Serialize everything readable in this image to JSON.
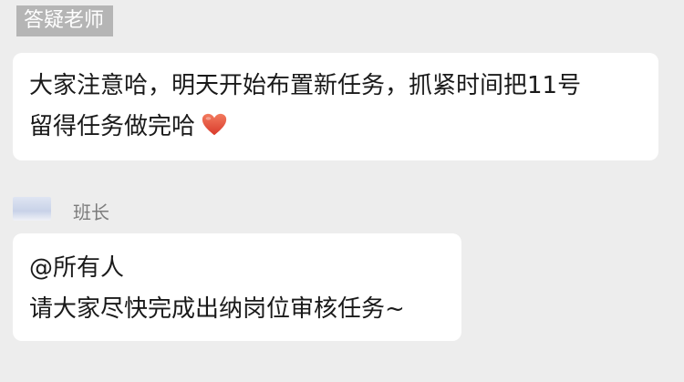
{
  "chat": {
    "messages": [
      {
        "sender": "答疑老师",
        "lines": [
          "大家注意哈，明天开始布置新任务，抓紧时间把11号",
          "留得任务做完哈"
        ],
        "emoji": "heart-icon"
      },
      {
        "sender": "班长",
        "lines": [
          "@所有人",
          "请大家尽快完成出纳岗位审核任务~"
        ]
      }
    ]
  },
  "colors": {
    "background": "#ededed",
    "bubble": "#ffffff",
    "name_tag_bg": "#b5b5b5",
    "heart": "#e8503f"
  }
}
